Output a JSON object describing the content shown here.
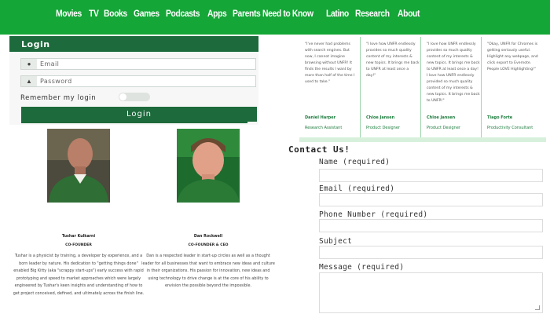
{
  "nav": {
    "items": [
      "Movies",
      "TV",
      "Books",
      "Games",
      "Podcasts",
      "Apps",
      "Parents Need to Know",
      "Latino",
      "Research",
      "About"
    ]
  },
  "login": {
    "title": "Login",
    "email_placeholder": "Email",
    "password_placeholder": "Password",
    "remember_label": "Remember my login",
    "button_label": "Login"
  },
  "testimonials": [
    {
      "quote": "\"I've never had problems with search engines. But now, I cannot imagine browsing without UNFR! It finds the results I want by more than half of the time I used to take.\"",
      "name": "Daniel Harper",
      "role": "Research Assistant"
    },
    {
      "quote": "\"I love how UNFR endlessly provides so much quality content of my interests & new topics. It brings me back to UNFR at least once a day!\"",
      "name": "Chloe Jansen",
      "role": "Product Designer"
    },
    {
      "quote": "\"I love how UNFR endlessly provides so much quality content of my interests & new topics. It brings me back to UNFR at least once a day! I love how UNFR endlessly provided so much quality content of my interests & new topics. It brings me back to UNFR!\"",
      "name": "Chloe Jansen",
      "role": "Product Designer"
    },
    {
      "quote": "\"Okay, UNFR for Chromes is getting seriously useful. Highlight any webpage, and click export to Evernote. People LOVE Highlighting!\"",
      "name": "Tiago Forte",
      "role": "Productivity Consultant"
    }
  ],
  "team": [
    {
      "name": "Tushar Kulkarni",
      "title": "CO-FOUNDER",
      "bio": "Tushar is a physicist by training, a developer by experience, and a born leader by nature. His dedication to \"getting things done\" enabled Big Kitty (aka \"scrappy start-ups\") early success with rapid prototyping and speed to market approaches which were largely engineered by Tushar's keen insights and understanding of how to get project conceived, defined, and ultimately across the finish line."
    },
    {
      "name": "Dan Rockwell",
      "title": "CO-FOUNDER & CEO",
      "bio": "Dan is a respected leader in start-up circles as well as a thought leader for all businesses that want to embrace new ideas and culture in their organizations. His passion for innovation, new ideas and using technology to drive change is at the core of his ability to envision the possible beyond the impossible."
    }
  ],
  "contact": {
    "title": "Contact Us!",
    "fields": [
      "Name (required)",
      "Email (required)",
      "Phone Number (required)",
      "Subject",
      "Message (required)"
    ]
  },
  "colors": {
    "nav_green": "#14a637",
    "dark_green": "#1d6a3c"
  }
}
